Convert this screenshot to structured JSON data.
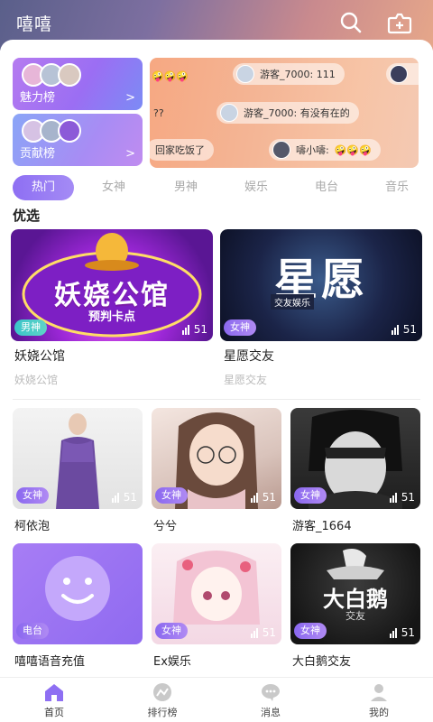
{
  "header": {
    "title": "嘻嘻",
    "search_icon": "search-icon",
    "add_icon": "add-room-icon"
  },
  "ranks": {
    "charm_label": "魅力榜",
    "contribution_label": "贡献榜",
    "arrow": ">"
  },
  "chat": {
    "messages": [
      {
        "text": "游客_7000:   111"
      },
      {
        "text": "游客_7000:   有没有在的"
      },
      {
        "text": "回家吃饭了"
      },
      {
        "text": "嚋小嚋:"
      },
      {
        "text": "??"
      }
    ],
    "emoji": "🤪🤪🤪"
  },
  "tabs": [
    "热门",
    "女神",
    "男神",
    "娱乐",
    "电台",
    "音乐"
  ],
  "section_title": "优选",
  "featured": [
    {
      "name": "妖娆公馆",
      "sub": "妖娆公馆",
      "tag": "男神",
      "count": "51",
      "art_title": "妖娆公馆",
      "art_sub": "预判卡点"
    },
    {
      "name": "星愿交友",
      "sub": "星愿交友",
      "tag": "女神",
      "count": "51",
      "art_title": "星愿",
      "art_sub": "交友娱乐"
    }
  ],
  "rooms": [
    {
      "name": "柯依泡",
      "tag": "女神",
      "count": "51"
    },
    {
      "name": "兮兮",
      "tag": "女神",
      "count": "51"
    },
    {
      "name": "游客_1664",
      "tag": "女神",
      "count": "51"
    },
    {
      "name": "嘻嘻语音充值",
      "tag": "电台",
      "count": "51"
    },
    {
      "name": "Ex娱乐",
      "tag": "女神",
      "count": "51"
    },
    {
      "name": "大白鹅交友",
      "tag": "女神",
      "count": "51",
      "art_title": "大白鹅",
      "art_sub": "交友"
    }
  ],
  "nav": [
    {
      "label": "首页",
      "icon": "home-icon"
    },
    {
      "label": "排行榜",
      "icon": "ranking-icon"
    },
    {
      "label": "消息",
      "icon": "message-icon"
    },
    {
      "label": "我的",
      "icon": "profile-icon"
    }
  ],
  "colors": {
    "accent": "#8e6ff3",
    "male_tag": "#3ac4c9"
  }
}
